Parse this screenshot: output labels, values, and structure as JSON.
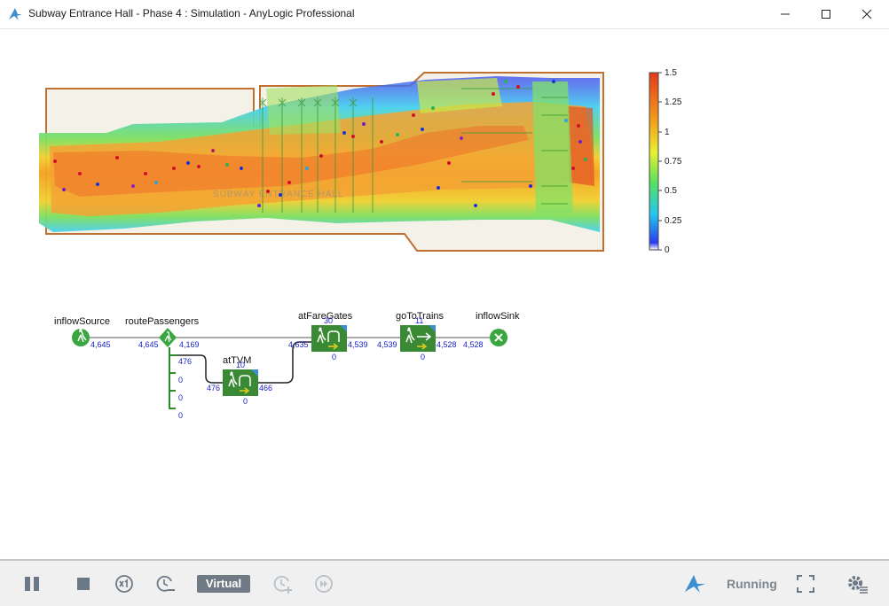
{
  "window": {
    "title": "Subway Entrance Hall - Phase 4 : Simulation - AnyLogic Professional"
  },
  "colors": {
    "accent": "#3c8fd1",
    "block_green": "#3a8a35",
    "count_blue": "#1a22c8",
    "legend_stops": [
      "#ffffff",
      "#2b3cf0",
      "#20c8f0",
      "#58e060",
      "#e8f030",
      "#f4a21a",
      "#e43a1a"
    ]
  },
  "layout_label": "SUBWAY ENTRANCE HALL",
  "legend": {
    "ticks": [
      "1.5",
      "1.25",
      "1",
      "0.75",
      "0.5",
      "0.25",
      "0"
    ]
  },
  "flowchart": {
    "inflowSource": {
      "label": "inflowSource",
      "out": "4,645"
    },
    "routePassengers": {
      "label": "routePassengers",
      "in": "4,645",
      "outs": [
        "4,169",
        "476",
        "0",
        "0",
        "0"
      ]
    },
    "atTVM": {
      "label": "atTVM",
      "top": "10",
      "in": "476",
      "out": "466",
      "bottom": "0"
    },
    "atFareGates": {
      "label": "atFareGates",
      "top": "30",
      "in": "4,635",
      "out": "4,539",
      "bottom": "0"
    },
    "goToTrains": {
      "label": "goToTrains",
      "top": "11",
      "in": "4,539",
      "out": "4,528",
      "bottom": "0"
    },
    "inflowSink": {
      "label": "inflowSink",
      "in": "4,528"
    }
  },
  "toolbar": {
    "time_mode": "Virtual",
    "status": "Running",
    "icons": [
      "pause-icon",
      "stop-icon",
      "speed-x1-icon",
      "slower-icon",
      "faster-icon",
      "run-until-icon",
      "anylogic-logo",
      "fullscreen-icon",
      "settings-icon"
    ]
  }
}
